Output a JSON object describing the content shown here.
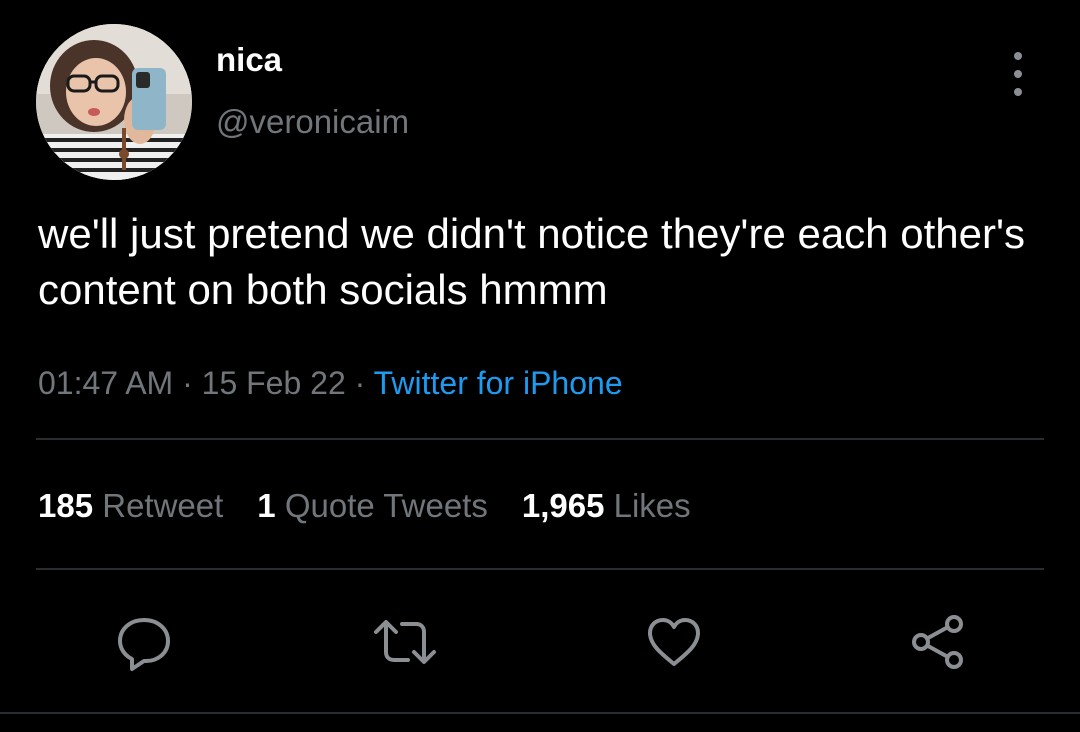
{
  "user": {
    "display_name": "nica",
    "handle": "@veronicaim"
  },
  "tweet": {
    "text": "we'll just pretend we didn't notice they're each other's content on both socials hmmm",
    "time": "01:47 AM",
    "date": "15 Feb 22",
    "source": "Twitter for iPhone",
    "separator": " · "
  },
  "stats": {
    "retweets": "185",
    "retweets_label": "Retweet",
    "quotes": "1",
    "quotes_label": "Quote Tweets",
    "likes": "1,965",
    "likes_label": "Likes"
  },
  "icons": {
    "more": "more-vertical-icon",
    "reply": "reply-icon",
    "retweet": "retweet-icon",
    "like": "heart-icon",
    "share": "share-icon"
  },
  "colors": {
    "background": "#000000",
    "text": "#ffffff",
    "muted": "#71767b",
    "link": "#1d9bf0",
    "divider": "#2a2d30"
  }
}
